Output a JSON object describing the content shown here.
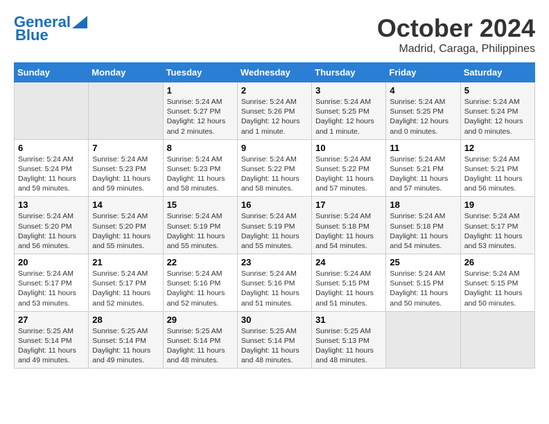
{
  "logo": {
    "line1": "General",
    "line2": "Blue"
  },
  "title": "October 2024",
  "subtitle": "Madrid, Caraga, Philippines",
  "headers": [
    "Sunday",
    "Monday",
    "Tuesday",
    "Wednesday",
    "Thursday",
    "Friday",
    "Saturday"
  ],
  "weeks": [
    [
      {
        "day": "",
        "empty": true
      },
      {
        "day": "",
        "empty": true
      },
      {
        "day": "1",
        "sunrise": "Sunrise: 5:24 AM",
        "sunset": "Sunset: 5:27 PM",
        "daylight": "Daylight: 12 hours and 2 minutes."
      },
      {
        "day": "2",
        "sunrise": "Sunrise: 5:24 AM",
        "sunset": "Sunset: 5:26 PM",
        "daylight": "Daylight: 12 hours and 1 minute."
      },
      {
        "day": "3",
        "sunrise": "Sunrise: 5:24 AM",
        "sunset": "Sunset: 5:25 PM",
        "daylight": "Daylight: 12 hours and 1 minute."
      },
      {
        "day": "4",
        "sunrise": "Sunrise: 5:24 AM",
        "sunset": "Sunset: 5:25 PM",
        "daylight": "Daylight: 12 hours and 0 minutes."
      },
      {
        "day": "5",
        "sunrise": "Sunrise: 5:24 AM",
        "sunset": "Sunset: 5:24 PM",
        "daylight": "Daylight: 12 hours and 0 minutes."
      }
    ],
    [
      {
        "day": "6",
        "sunrise": "Sunrise: 5:24 AM",
        "sunset": "Sunset: 5:24 PM",
        "daylight": "Daylight: 11 hours and 59 minutes."
      },
      {
        "day": "7",
        "sunrise": "Sunrise: 5:24 AM",
        "sunset": "Sunset: 5:23 PM",
        "daylight": "Daylight: 11 hours and 59 minutes."
      },
      {
        "day": "8",
        "sunrise": "Sunrise: 5:24 AM",
        "sunset": "Sunset: 5:23 PM",
        "daylight": "Daylight: 11 hours and 58 minutes."
      },
      {
        "day": "9",
        "sunrise": "Sunrise: 5:24 AM",
        "sunset": "Sunset: 5:22 PM",
        "daylight": "Daylight: 11 hours and 58 minutes."
      },
      {
        "day": "10",
        "sunrise": "Sunrise: 5:24 AM",
        "sunset": "Sunset: 5:22 PM",
        "daylight": "Daylight: 11 hours and 57 minutes."
      },
      {
        "day": "11",
        "sunrise": "Sunrise: 5:24 AM",
        "sunset": "Sunset: 5:21 PM",
        "daylight": "Daylight: 11 hours and 57 minutes."
      },
      {
        "day": "12",
        "sunrise": "Sunrise: 5:24 AM",
        "sunset": "Sunset: 5:21 PM",
        "daylight": "Daylight: 11 hours and 56 minutes."
      }
    ],
    [
      {
        "day": "13",
        "sunrise": "Sunrise: 5:24 AM",
        "sunset": "Sunset: 5:20 PM",
        "daylight": "Daylight: 11 hours and 56 minutes."
      },
      {
        "day": "14",
        "sunrise": "Sunrise: 5:24 AM",
        "sunset": "Sunset: 5:20 PM",
        "daylight": "Daylight: 11 hours and 55 minutes."
      },
      {
        "day": "15",
        "sunrise": "Sunrise: 5:24 AM",
        "sunset": "Sunset: 5:19 PM",
        "daylight": "Daylight: 11 hours and 55 minutes."
      },
      {
        "day": "16",
        "sunrise": "Sunrise: 5:24 AM",
        "sunset": "Sunset: 5:19 PM",
        "daylight": "Daylight: 11 hours and 55 minutes."
      },
      {
        "day": "17",
        "sunrise": "Sunrise: 5:24 AM",
        "sunset": "Sunset: 5:18 PM",
        "daylight": "Daylight: 11 hours and 54 minutes."
      },
      {
        "day": "18",
        "sunrise": "Sunrise: 5:24 AM",
        "sunset": "Sunset: 5:18 PM",
        "daylight": "Daylight: 11 hours and 54 minutes."
      },
      {
        "day": "19",
        "sunrise": "Sunrise: 5:24 AM",
        "sunset": "Sunset: 5:17 PM",
        "daylight": "Daylight: 11 hours and 53 minutes."
      }
    ],
    [
      {
        "day": "20",
        "sunrise": "Sunrise: 5:24 AM",
        "sunset": "Sunset: 5:17 PM",
        "daylight": "Daylight: 11 hours and 53 minutes."
      },
      {
        "day": "21",
        "sunrise": "Sunrise: 5:24 AM",
        "sunset": "Sunset: 5:17 PM",
        "daylight": "Daylight: 11 hours and 52 minutes."
      },
      {
        "day": "22",
        "sunrise": "Sunrise: 5:24 AM",
        "sunset": "Sunset: 5:16 PM",
        "daylight": "Daylight: 11 hours and 52 minutes."
      },
      {
        "day": "23",
        "sunrise": "Sunrise: 5:24 AM",
        "sunset": "Sunset: 5:16 PM",
        "daylight": "Daylight: 11 hours and 51 minutes."
      },
      {
        "day": "24",
        "sunrise": "Sunrise: 5:24 AM",
        "sunset": "Sunset: 5:15 PM",
        "daylight": "Daylight: 11 hours and 51 minutes."
      },
      {
        "day": "25",
        "sunrise": "Sunrise: 5:24 AM",
        "sunset": "Sunset: 5:15 PM",
        "daylight": "Daylight: 11 hours and 50 minutes."
      },
      {
        "day": "26",
        "sunrise": "Sunrise: 5:24 AM",
        "sunset": "Sunset: 5:15 PM",
        "daylight": "Daylight: 11 hours and 50 minutes."
      }
    ],
    [
      {
        "day": "27",
        "sunrise": "Sunrise: 5:25 AM",
        "sunset": "Sunset: 5:14 PM",
        "daylight": "Daylight: 11 hours and 49 minutes."
      },
      {
        "day": "28",
        "sunrise": "Sunrise: 5:25 AM",
        "sunset": "Sunset: 5:14 PM",
        "daylight": "Daylight: 11 hours and 49 minutes."
      },
      {
        "day": "29",
        "sunrise": "Sunrise: 5:25 AM",
        "sunset": "Sunset: 5:14 PM",
        "daylight": "Daylight: 11 hours and 48 minutes."
      },
      {
        "day": "30",
        "sunrise": "Sunrise: 5:25 AM",
        "sunset": "Sunset: 5:14 PM",
        "daylight": "Daylight: 11 hours and 48 minutes."
      },
      {
        "day": "31",
        "sunrise": "Sunrise: 5:25 AM",
        "sunset": "Sunset: 5:13 PM",
        "daylight": "Daylight: 11 hours and 48 minutes."
      },
      {
        "day": "",
        "empty": true
      },
      {
        "day": "",
        "empty": true
      }
    ]
  ]
}
